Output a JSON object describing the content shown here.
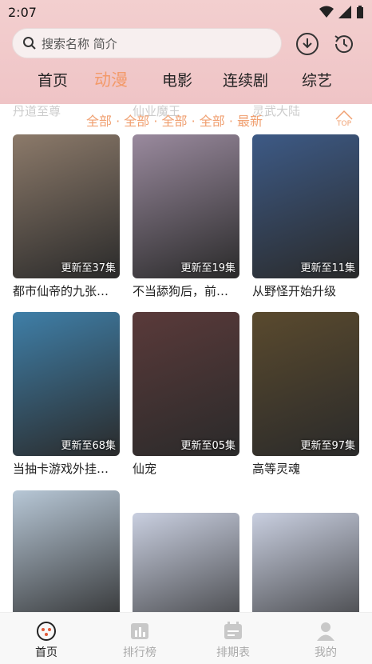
{
  "status": {
    "time": "2:07"
  },
  "search": {
    "placeholder": "搜索名称 简介"
  },
  "tabs": [
    "首页",
    "动漫",
    "电影",
    "连续剧",
    "综艺"
  ],
  "ghost_titles": [
    "丹道至尊",
    "仙业魔王",
    "灵武大陆"
  ],
  "filter": "全部 · 全部 · 全部 · 全部 · 最新",
  "top_label": "TOP",
  "cards": [
    {
      "title": "都市仙帝的九张…",
      "badge": "更新至37集",
      "bg": "#8c7a6a"
    },
    {
      "title": "不当舔狗后，前…",
      "badge": "更新至19集",
      "bg": "#9a8a9e"
    },
    {
      "title": "从野怪开始升级",
      "badge": "更新至11集",
      "bg": "#3d5a86"
    },
    {
      "title": "当抽卡游戏外挂…",
      "badge": "更新至68集",
      "bg": "#3f7fa8"
    },
    {
      "title": "仙宠",
      "badge": "更新至05集",
      "bg": "#5a3a3a"
    },
    {
      "title": "高等灵魂",
      "badge": "更新至97集",
      "bg": "#5a4a2e"
    },
    {
      "title": "",
      "badge": "",
      "bg": "#b7c7d6"
    },
    {
      "title": "",
      "badge": "",
      "bg": "#c9cfe0"
    },
    {
      "title": "",
      "badge": "",
      "bg": "#c9cfe0"
    }
  ],
  "nav": [
    "首页",
    "排行榜",
    "排期表",
    "我的"
  ],
  "colors": {
    "accent": "#f39a6a",
    "header_bg": "#f3cfcf"
  }
}
